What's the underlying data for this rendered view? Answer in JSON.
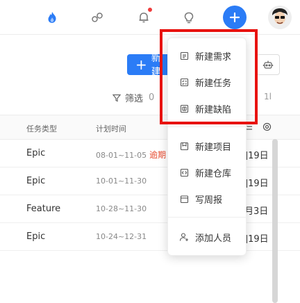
{
  "topbar": {
    "icons": [
      "fire-icon",
      "link-icon",
      "bell-icon",
      "bulb-icon",
      "plus-icon",
      "avatar"
    ],
    "bell_has_badge": true,
    "accent_color": "#2b7cf6"
  },
  "toolbar": {
    "new_button_label": "新建",
    "filter_label": "筛选",
    "filter_count": "0",
    "right_edge_text": "1l"
  },
  "table": {
    "headers": {
      "type": "任务类型",
      "plan": "计划时间"
    },
    "rows": [
      {
        "type": "Epic",
        "plan": "08-01~11-05",
        "overdue": "逾期",
        "right": "]19日"
      },
      {
        "type": "Epic",
        "plan": "10-01~11-30",
        "overdue": "",
        "right": "]19日"
      },
      {
        "type": "Feature",
        "plan": "10-28~11-30",
        "overdue": "",
        "right": "月3日"
      },
      {
        "type": "Epic",
        "plan": "10-24~12-31",
        "overdue": "",
        "right": "]19日"
      }
    ]
  },
  "menu": {
    "items": [
      {
        "label": "新建需求",
        "icon": "document-icon"
      },
      {
        "label": "新建任务",
        "icon": "checklist-icon"
      },
      {
        "label": "新建缺陷",
        "icon": "bug-icon"
      },
      {
        "label": "新建项目",
        "icon": "project-icon"
      },
      {
        "label": "新建仓库",
        "icon": "repo-icon"
      },
      {
        "label": "写周报",
        "icon": "calendar-icon"
      },
      {
        "label": "添加人员",
        "icon": "add-user-icon"
      }
    ]
  },
  "highlight_color": "#e8120f"
}
